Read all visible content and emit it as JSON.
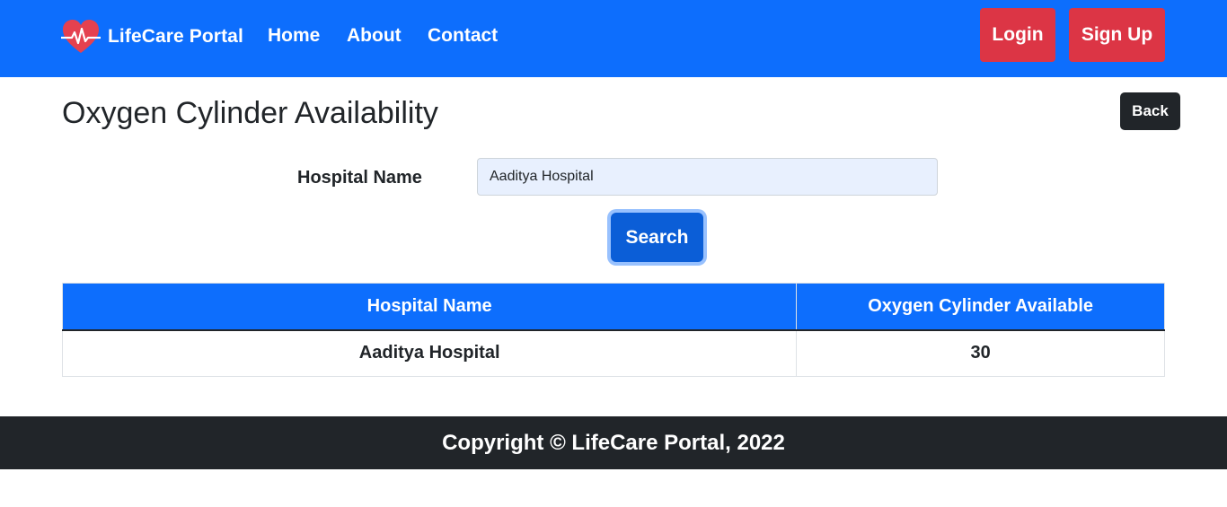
{
  "navbar": {
    "brand": "LifeCare Portal",
    "brand_icon": "heartbeat-icon",
    "links": [
      "Home",
      "About",
      "Contact"
    ],
    "login_label": "Login",
    "signup_label": "Sign Up"
  },
  "page": {
    "title": "Oxygen Cylinder Availability",
    "back_label": "Back"
  },
  "search": {
    "label": "Hospital Name",
    "value": "Aaditya Hospital",
    "button_label": "Search"
  },
  "table": {
    "headers": [
      "Hospital Name",
      "Oxygen Cylinder Available"
    ],
    "rows": [
      [
        "Aaditya Hospital",
        "30"
      ]
    ]
  },
  "footer": {
    "text": "Copyright © LifeCare Portal, 2022"
  },
  "colors": {
    "primary": "#0d6efd",
    "danger": "#dc3545",
    "dark": "#212529"
  }
}
